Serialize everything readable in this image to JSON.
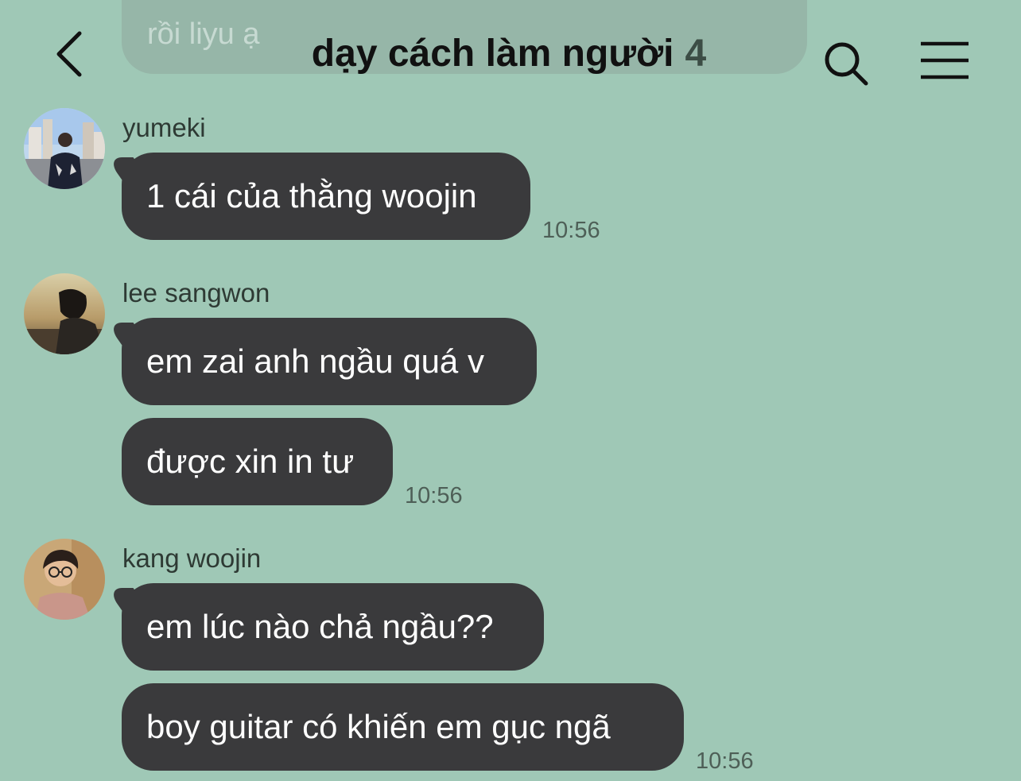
{
  "header": {
    "title": "dạy cách làm người",
    "member_count": "4"
  },
  "background_message": {
    "text": "rồi liyu ạ"
  },
  "messages": [
    {
      "sender": "yumeki",
      "avatar": "avatar-yumeki",
      "bubbles": [
        "1 cái của thằng woojin"
      ],
      "time": "10:56"
    },
    {
      "sender": "lee sangwon",
      "avatar": "avatar-lee-sangwon",
      "bubbles": [
        "em zai anh ngầu quá v",
        "được xin in tư"
      ],
      "time": "10:56"
    },
    {
      "sender": "kang woojin",
      "avatar": "avatar-kang-woojin",
      "bubbles": [
        "em lúc nào chả ngầu??",
        "boy guitar có khiến em gục ngã"
      ],
      "time": "10:56"
    }
  ],
  "colors": {
    "background": "#9fc8b6",
    "bubble": "#3a3a3c",
    "bubble_text": "#ffffff",
    "title": "#111111",
    "timestamp": "#4e5f57"
  },
  "icons": {
    "back": "chevron-left-icon",
    "search": "search-icon",
    "menu": "hamburger-menu-icon"
  }
}
